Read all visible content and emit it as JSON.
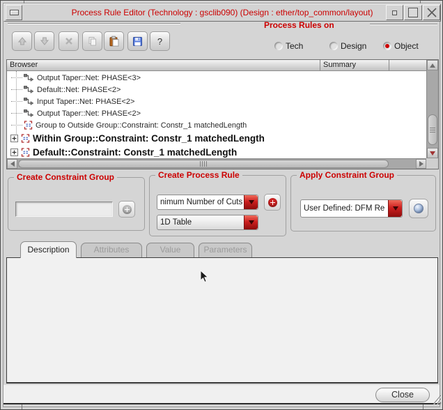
{
  "window": {
    "title": "Process Rule Editor (Technology : gsclib090) (Design : ether/top_common/layout)"
  },
  "toolbar": {
    "buttons": [
      {
        "name": "move-up",
        "icon": "arrow-up-icon",
        "enabled": false
      },
      {
        "name": "move-down",
        "icon": "arrow-down-icon",
        "enabled": false
      },
      {
        "name": "delete",
        "icon": "x-icon",
        "enabled": false
      },
      {
        "name": "copy",
        "icon": "copy-icon",
        "enabled": false
      },
      {
        "name": "paste",
        "icon": "paste-icon",
        "enabled": true
      },
      {
        "name": "save",
        "icon": "save-icon",
        "enabled": true
      },
      {
        "name": "help",
        "icon": "help-icon",
        "label": "?",
        "enabled": true
      }
    ]
  },
  "process_rules_on": {
    "label": "Process Rules on",
    "options": [
      {
        "label": "Tech",
        "selected": false
      },
      {
        "label": "Design",
        "selected": false
      },
      {
        "label": "Object",
        "selected": true
      }
    ]
  },
  "browser": {
    "columns": [
      "Browser",
      "Summary"
    ],
    "items": [
      {
        "text": "Output Taper::Net: PHASE<3>",
        "icon": "net-icon",
        "bold": false,
        "expandable": false
      },
      {
        "text": "Default::Net: PHASE<2>",
        "icon": "net-icon",
        "bold": false,
        "expandable": false
      },
      {
        "text": "Input Taper::Net: PHASE<2>",
        "icon": "net-icon",
        "bold": false,
        "expandable": false
      },
      {
        "text": "Output Taper::Net: PHASE<2>",
        "icon": "net-icon",
        "bold": false,
        "expandable": false
      },
      {
        "text": "Group to Outside Group::Constraint: Constr_1 matchedLength",
        "icon": "constraint-icon",
        "bold": false,
        "expandable": false
      },
      {
        "text": "Within Group::Constraint: Constr_1 matchedLength",
        "icon": "constraint-icon",
        "bold": true,
        "expandable": true
      },
      {
        "text": "Default::Constraint: Constr_1 matchedLength",
        "icon": "constraint-icon",
        "bold": true,
        "expandable": true
      }
    ]
  },
  "create_constraint_group": {
    "label": "Create Constraint Group",
    "input_value": ""
  },
  "create_process_rule": {
    "label": "Create Process Rule",
    "rule_type_value": "nimum Number of Cuts",
    "table_type_value": "1D Table"
  },
  "apply_constraint_group": {
    "label": "Apply Constraint Group",
    "group_value": "User Defined: DFM Re"
  },
  "tabs": [
    {
      "label": "Description",
      "active": true
    },
    {
      "label": "Attributes",
      "active": false
    },
    {
      "label": "Value",
      "active": false
    },
    {
      "label": "Parameters",
      "active": false
    }
  ],
  "footer": {
    "close_label": "Close"
  },
  "colors": {
    "accent_red": "#cc0000",
    "combo_arrow_red": "#cd1f1f",
    "save_blue": "#5a7edc"
  }
}
